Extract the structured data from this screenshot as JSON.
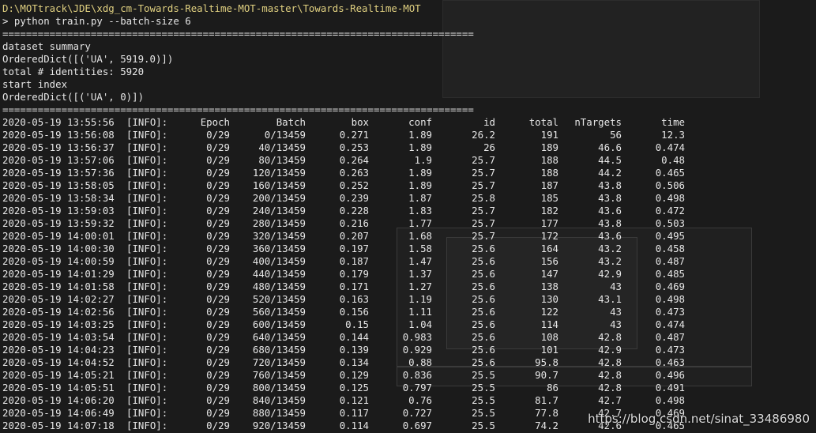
{
  "console": {
    "path_line": "D:\\MOTtrack\\JDE\\xdg_cm-Towards-Realtime-MOT-master\\Towards-Realtime-MOT",
    "command_line": "> python train.py --batch-size 6",
    "separator": "================================================================================",
    "summary_lines": [
      "dataset summary",
      "OrderedDict([('UA', 5919.0)])",
      "total # identities: 5920",
      "start index",
      "OrderedDict([('UA', 0)])"
    ]
  },
  "log": {
    "header": {
      "timestamp": "2020-05-19 13:55:56",
      "tag": "[INFO]:",
      "epoch": "Epoch",
      "batch": "Batch",
      "box": "box",
      "conf": "conf",
      "id": "id",
      "total": "total",
      "ntargets": "nTargets",
      "time": "time"
    },
    "rows": [
      {
        "timestamp": "2020-05-19 13:56:08",
        "tag": "[INFO]:",
        "epoch": "0/29",
        "batch": "0/13459",
        "box": "0.271",
        "conf": "1.89",
        "id": "26.2",
        "total": "191",
        "ntargets": "56",
        "time": "12.3"
      },
      {
        "timestamp": "2020-05-19 13:56:37",
        "tag": "[INFO]:",
        "epoch": "0/29",
        "batch": "40/13459",
        "box": "0.253",
        "conf": "1.89",
        "id": "26",
        "total": "189",
        "ntargets": "46.6",
        "time": "0.474"
      },
      {
        "timestamp": "2020-05-19 13:57:06",
        "tag": "[INFO]:",
        "epoch": "0/29",
        "batch": "80/13459",
        "box": "0.264",
        "conf": "1.9",
        "id": "25.7",
        "total": "188",
        "ntargets": "44.5",
        "time": "0.48"
      },
      {
        "timestamp": "2020-05-19 13:57:36",
        "tag": "[INFO]:",
        "epoch": "0/29",
        "batch": "120/13459",
        "box": "0.263",
        "conf": "1.89",
        "id": "25.7",
        "total": "188",
        "ntargets": "44.2",
        "time": "0.465"
      },
      {
        "timestamp": "2020-05-19 13:58:05",
        "tag": "[INFO]:",
        "epoch": "0/29",
        "batch": "160/13459",
        "box": "0.252",
        "conf": "1.89",
        "id": "25.7",
        "total": "187",
        "ntargets": "43.8",
        "time": "0.506"
      },
      {
        "timestamp": "2020-05-19 13:58:34",
        "tag": "[INFO]:",
        "epoch": "0/29",
        "batch": "200/13459",
        "box": "0.239",
        "conf": "1.87",
        "id": "25.8",
        "total": "185",
        "ntargets": "43.8",
        "time": "0.498"
      },
      {
        "timestamp": "2020-05-19 13:59:03",
        "tag": "[INFO]:",
        "epoch": "0/29",
        "batch": "240/13459",
        "box": "0.228",
        "conf": "1.83",
        "id": "25.7",
        "total": "182",
        "ntargets": "43.6",
        "time": "0.472"
      },
      {
        "timestamp": "2020-05-19 13:59:32",
        "tag": "[INFO]:",
        "epoch": "0/29",
        "batch": "280/13459",
        "box": "0.216",
        "conf": "1.77",
        "id": "25.7",
        "total": "177",
        "ntargets": "43.8",
        "time": "0.503"
      },
      {
        "timestamp": "2020-05-19 14:00:01",
        "tag": "[INFO]:",
        "epoch": "0/29",
        "batch": "320/13459",
        "box": "0.207",
        "conf": "1.68",
        "id": "25.7",
        "total": "172",
        "ntargets": "43.6",
        "time": "0.495"
      },
      {
        "timestamp": "2020-05-19 14:00:30",
        "tag": "[INFO]:",
        "epoch": "0/29",
        "batch": "360/13459",
        "box": "0.197",
        "conf": "1.58",
        "id": "25.6",
        "total": "164",
        "ntargets": "43.2",
        "time": "0.458"
      },
      {
        "timestamp": "2020-05-19 14:00:59",
        "tag": "[INFO]:",
        "epoch": "0/29",
        "batch": "400/13459",
        "box": "0.187",
        "conf": "1.47",
        "id": "25.6",
        "total": "156",
        "ntargets": "43.2",
        "time": "0.487"
      },
      {
        "timestamp": "2020-05-19 14:01:29",
        "tag": "[INFO]:",
        "epoch": "0/29",
        "batch": "440/13459",
        "box": "0.179",
        "conf": "1.37",
        "id": "25.6",
        "total": "147",
        "ntargets": "42.9",
        "time": "0.485"
      },
      {
        "timestamp": "2020-05-19 14:01:58",
        "tag": "[INFO]:",
        "epoch": "0/29",
        "batch": "480/13459",
        "box": "0.171",
        "conf": "1.27",
        "id": "25.6",
        "total": "138",
        "ntargets": "43",
        "time": "0.469"
      },
      {
        "timestamp": "2020-05-19 14:02:27",
        "tag": "[INFO]:",
        "epoch": "0/29",
        "batch": "520/13459",
        "box": "0.163",
        "conf": "1.19",
        "id": "25.6",
        "total": "130",
        "ntargets": "43.1",
        "time": "0.498"
      },
      {
        "timestamp": "2020-05-19 14:02:56",
        "tag": "[INFO]:",
        "epoch": "0/29",
        "batch": "560/13459",
        "box": "0.156",
        "conf": "1.11",
        "id": "25.6",
        "total": "122",
        "ntargets": "43",
        "time": "0.473"
      },
      {
        "timestamp": "2020-05-19 14:03:25",
        "tag": "[INFO]:",
        "epoch": "0/29",
        "batch": "600/13459",
        "box": "0.15",
        "conf": "1.04",
        "id": "25.6",
        "total": "114",
        "ntargets": "43",
        "time": "0.474"
      },
      {
        "timestamp": "2020-05-19 14:03:54",
        "tag": "[INFO]:",
        "epoch": "0/29",
        "batch": "640/13459",
        "box": "0.144",
        "conf": "0.983",
        "id": "25.6",
        "total": "108",
        "ntargets": "42.8",
        "time": "0.487"
      },
      {
        "timestamp": "2020-05-19 14:04:23",
        "tag": "[INFO]:",
        "epoch": "0/29",
        "batch": "680/13459",
        "box": "0.139",
        "conf": "0.929",
        "id": "25.6",
        "total": "101",
        "ntargets": "42.9",
        "time": "0.473"
      },
      {
        "timestamp": "2020-05-19 14:04:52",
        "tag": "[INFO]:",
        "epoch": "0/29",
        "batch": "720/13459",
        "box": "0.134",
        "conf": "0.88",
        "id": "25.6",
        "total": "95.8",
        "ntargets": "42.8",
        "time": "0.463"
      },
      {
        "timestamp": "2020-05-19 14:05:21",
        "tag": "[INFO]:",
        "epoch": "0/29",
        "batch": "760/13459",
        "box": "0.129",
        "conf": "0.836",
        "id": "25.5",
        "total": "90.7",
        "ntargets": "42.8",
        "time": "0.496"
      },
      {
        "timestamp": "2020-05-19 14:05:51",
        "tag": "[INFO]:",
        "epoch": "0/29",
        "batch": "800/13459",
        "box": "0.125",
        "conf": "0.797",
        "id": "25.5",
        "total": "86",
        "ntargets": "42.8",
        "time": "0.491"
      },
      {
        "timestamp": "2020-05-19 14:06:20",
        "tag": "[INFO]:",
        "epoch": "0/29",
        "batch": "840/13459",
        "box": "0.121",
        "conf": "0.76",
        "id": "25.5",
        "total": "81.7",
        "ntargets": "42.7",
        "time": "0.498"
      },
      {
        "timestamp": "2020-05-19 14:06:49",
        "tag": "[INFO]:",
        "epoch": "0/29",
        "batch": "880/13459",
        "box": "0.117",
        "conf": "0.727",
        "id": "25.5",
        "total": "77.8",
        "ntargets": "42.7",
        "time": "0.469"
      },
      {
        "timestamp": "2020-05-19 14:07:18",
        "tag": "[INFO]:",
        "epoch": "0/29",
        "batch": "920/13459",
        "box": "0.114",
        "conf": "0.697",
        "id": "25.5",
        "total": "74.2",
        "ntargets": "42.6",
        "time": "0.465"
      }
    ]
  },
  "watermark": "https://blog.csdn.net/sinat_33486980",
  "colors": {
    "background": "#1b1b1b",
    "text": "#e6e6e6",
    "path": "#e0d080"
  }
}
